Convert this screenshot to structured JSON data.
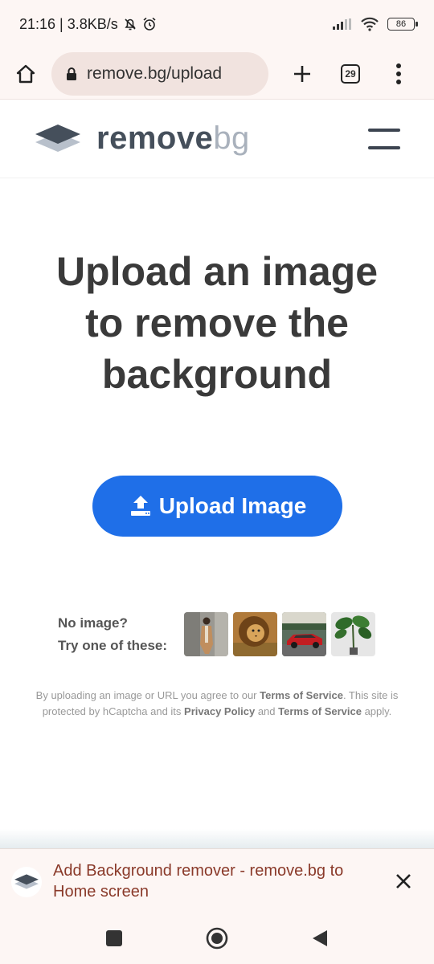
{
  "status": {
    "time_speed": "21:16 | 3.8KB/s",
    "battery": "86"
  },
  "browser": {
    "url": "remove.bg/upload",
    "tab_count": "29"
  },
  "site": {
    "logo_word1": "remove",
    "logo_word2": "bg"
  },
  "main": {
    "headline_line1": "Upload an image",
    "headline_line2": "to remove the",
    "headline_line3": "background",
    "upload_label": "Upload Image",
    "samples_line1": "No image?",
    "samples_line2": "Try one of these:",
    "sample_icons": [
      "woman-sample",
      "lion-sample",
      "car-sample",
      "plant-sample"
    ]
  },
  "terms": {
    "t1": "By uploading an image or URL you agree to our ",
    "tos1": "Terms of Service",
    "t2": ". This site is protected by hCaptcha and its ",
    "privacy": "Privacy Policy",
    "t3": " and ",
    "tos2": "Terms of Service",
    "t4": " apply."
  },
  "a2hs": {
    "text": "Add Background remover - remove.bg to Home screen"
  },
  "colors": {
    "accent": "#1f6fe8",
    "headline": "#3a3a3a",
    "a2hs_text": "#8a3a2a"
  }
}
